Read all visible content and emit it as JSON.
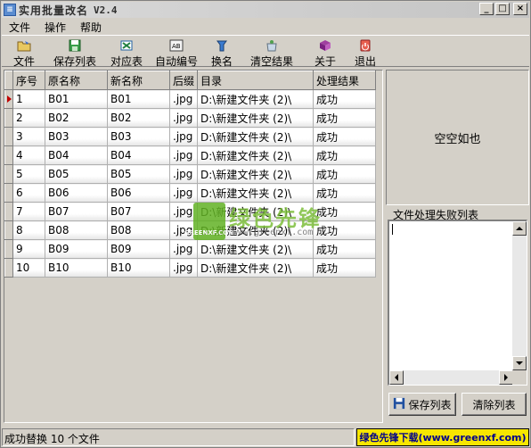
{
  "window": {
    "title": "实用批量改名",
    "version": "V2.4",
    "controls": [
      "_",
      "□",
      "×"
    ]
  },
  "menu": [
    "文件",
    "操作",
    "帮助"
  ],
  "toolbar": [
    {
      "label": "文件",
      "icon": "folder-icon"
    },
    {
      "label": "保存列表",
      "icon": "save-icon"
    },
    {
      "label": "对应表",
      "icon": "mapping-icon"
    },
    {
      "label": "自动编号",
      "icon": "autonumber-icon"
    },
    {
      "label": "换名",
      "icon": "rename-icon"
    },
    {
      "label": "清空结果",
      "icon": "clear-icon"
    },
    {
      "label": "关于",
      "icon": "about-icon"
    },
    {
      "label": "退出",
      "icon": "exit-icon"
    }
  ],
  "grid": {
    "columns": [
      "序号",
      "原名称",
      "新名称",
      "后缀",
      "目录",
      "处理结果"
    ],
    "rows": [
      [
        "1",
        "B01",
        "B01",
        ".jpg",
        "D:\\新建文件夹 (2)\\",
        "成功"
      ],
      [
        "2",
        "B02",
        "B02",
        ".jpg",
        "D:\\新建文件夹 (2)\\",
        "成功"
      ],
      [
        "3",
        "B03",
        "B03",
        ".jpg",
        "D:\\新建文件夹 (2)\\",
        "成功"
      ],
      [
        "4",
        "B04",
        "B04",
        ".jpg",
        "D:\\新建文件夹 (2)\\",
        "成功"
      ],
      [
        "5",
        "B05",
        "B05",
        ".jpg",
        "D:\\新建文件夹 (2)\\",
        "成功"
      ],
      [
        "6",
        "B06",
        "B06",
        ".jpg",
        "D:\\新建文件夹 (2)\\",
        "成功"
      ],
      [
        "7",
        "B07",
        "B07",
        ".jpg",
        "D:\\新建文件夹 (2)\\",
        "成功"
      ],
      [
        "8",
        "B08",
        "B08",
        ".jpg",
        "D:\\新建文件夹 (2)\\",
        "成功"
      ],
      [
        "9",
        "B09",
        "B09",
        ".jpg",
        "D:\\新建文件夹 (2)\\",
        "成功"
      ],
      [
        "10",
        "B10",
        "B10",
        ".jpg",
        "D:\\新建文件夹 (2)\\",
        "成功"
      ]
    ]
  },
  "right_panel": {
    "info": "空空如也",
    "fail_list_label": "文件处理失败列表",
    "save_button": "保存列表",
    "clear_button": "清除列表"
  },
  "status": {
    "text": "成功替换 10 个文件",
    "banner": "绿色先锋下载(www.greenxf.com)"
  },
  "watermark": {
    "logo_text": "GREENXF.COM",
    "brand": "绿色先锋",
    "url": "www.greenxf.com"
  },
  "colors": {
    "accent_green": "#62b224",
    "banner_yellow": "#f7e600",
    "row_marker": "#c00000"
  }
}
